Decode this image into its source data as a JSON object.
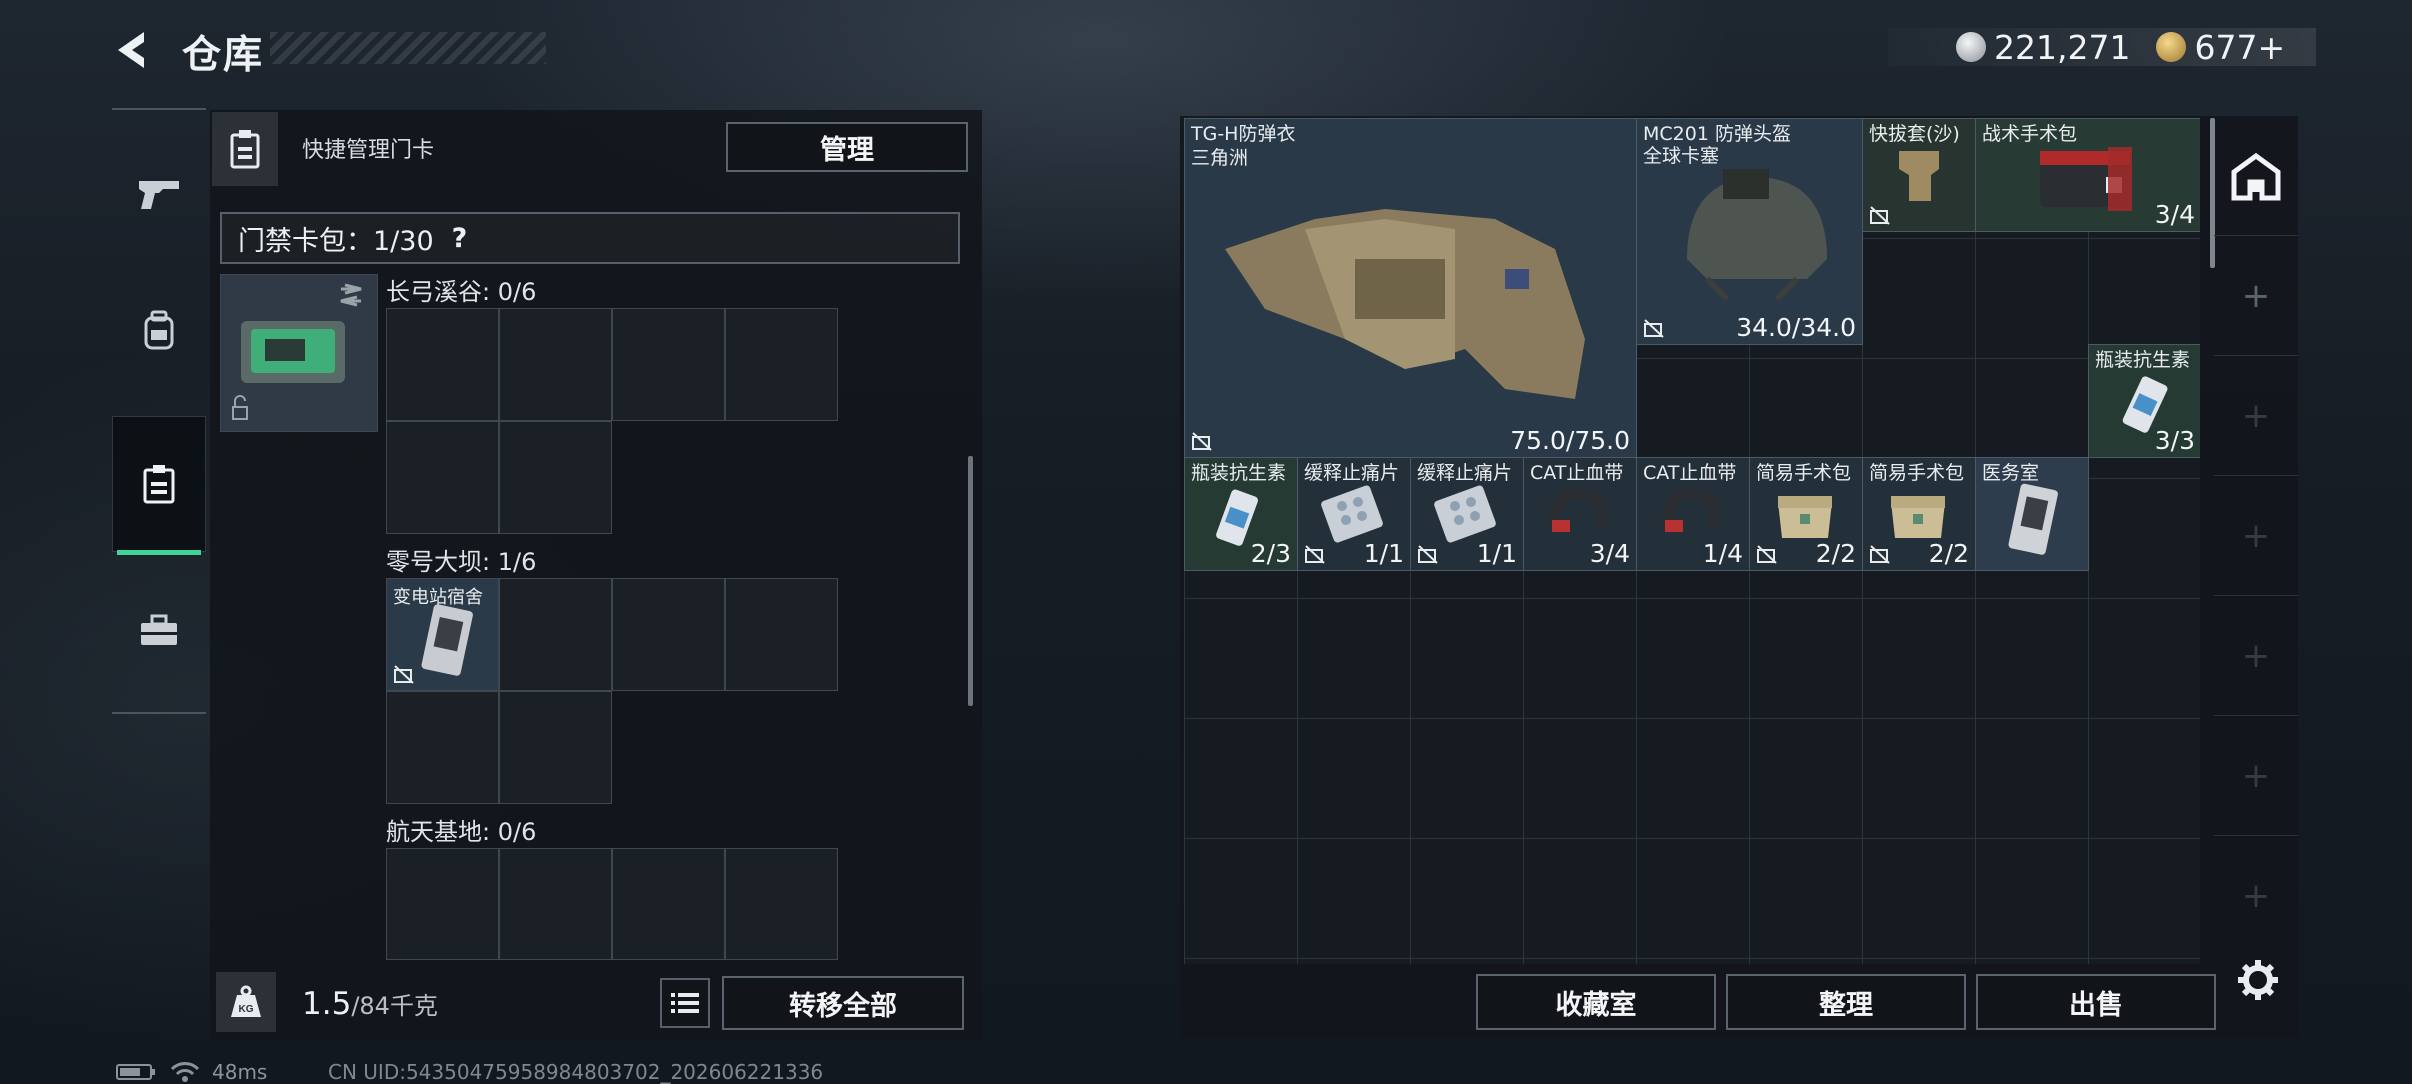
{
  "header": {
    "title": "仓库",
    "currency1": "221,271",
    "currency2": "677+"
  },
  "left_rail": {
    "tabs": [
      {
        "icon": "pistol-icon"
      },
      {
        "icon": "backpack-icon"
      },
      {
        "icon": "keycard-case-icon",
        "active": true
      },
      {
        "icon": "toolbox-icon"
      }
    ]
  },
  "left_panel": {
    "quick_label": "快捷管理门卡",
    "manage_button": "管理",
    "card_pack_label": "门禁卡包：1/30",
    "card_pack_help": "?",
    "maps": [
      {
        "label": "长弓溪谷: 0/6",
        "slots": []
      },
      {
        "label": "零号大坝: 1/6",
        "slots": [
          {
            "name": "变电站宿舍"
          }
        ]
      },
      {
        "label": "航天基地: 0/6",
        "slots": []
      }
    ],
    "weight": "1.5",
    "weight_cap": "/84千克",
    "transfer_all_button": "转移全部"
  },
  "status_bar": {
    "ping": "48ms",
    "uid": "CN UID:5435047595898480370​2_202606221336"
  },
  "inventory": {
    "items": [
      {
        "name": "TG-H防弹衣",
        "sub": "三角洲",
        "value": "75.0/75.0"
      },
      {
        "name": "MC201 防弹头盔",
        "sub": "全球卡塞",
        "value": "34.0/34.0"
      },
      {
        "name": "快拔套(沙)",
        "value": ""
      },
      {
        "name": "战术手术包",
        "value": "3/4"
      },
      {
        "name": "瓶装抗生素",
        "value": "3/3"
      },
      {
        "name": "瓶装抗生素",
        "value": "2/3"
      },
      {
        "name": "缓释止痛片",
        "value": "1/1"
      },
      {
        "name": "缓释止痛片",
        "value": "1/1"
      },
      {
        "name": "CAT止血带",
        "value": "3/4"
      },
      {
        "name": "CAT止血带",
        "value": "1/4"
      },
      {
        "name": "简易手术包",
        "value": "2/2"
      },
      {
        "name": "简易手术包",
        "value": "2/2"
      },
      {
        "name": "医务室",
        "value": ""
      }
    ],
    "buttons": {
      "collection": "收藏室",
      "sort": "整理",
      "sell": "出售"
    }
  },
  "colors": {
    "accent": "#41d39a",
    "panel": "#12161b",
    "filled_slot": "#2b3a48"
  }
}
